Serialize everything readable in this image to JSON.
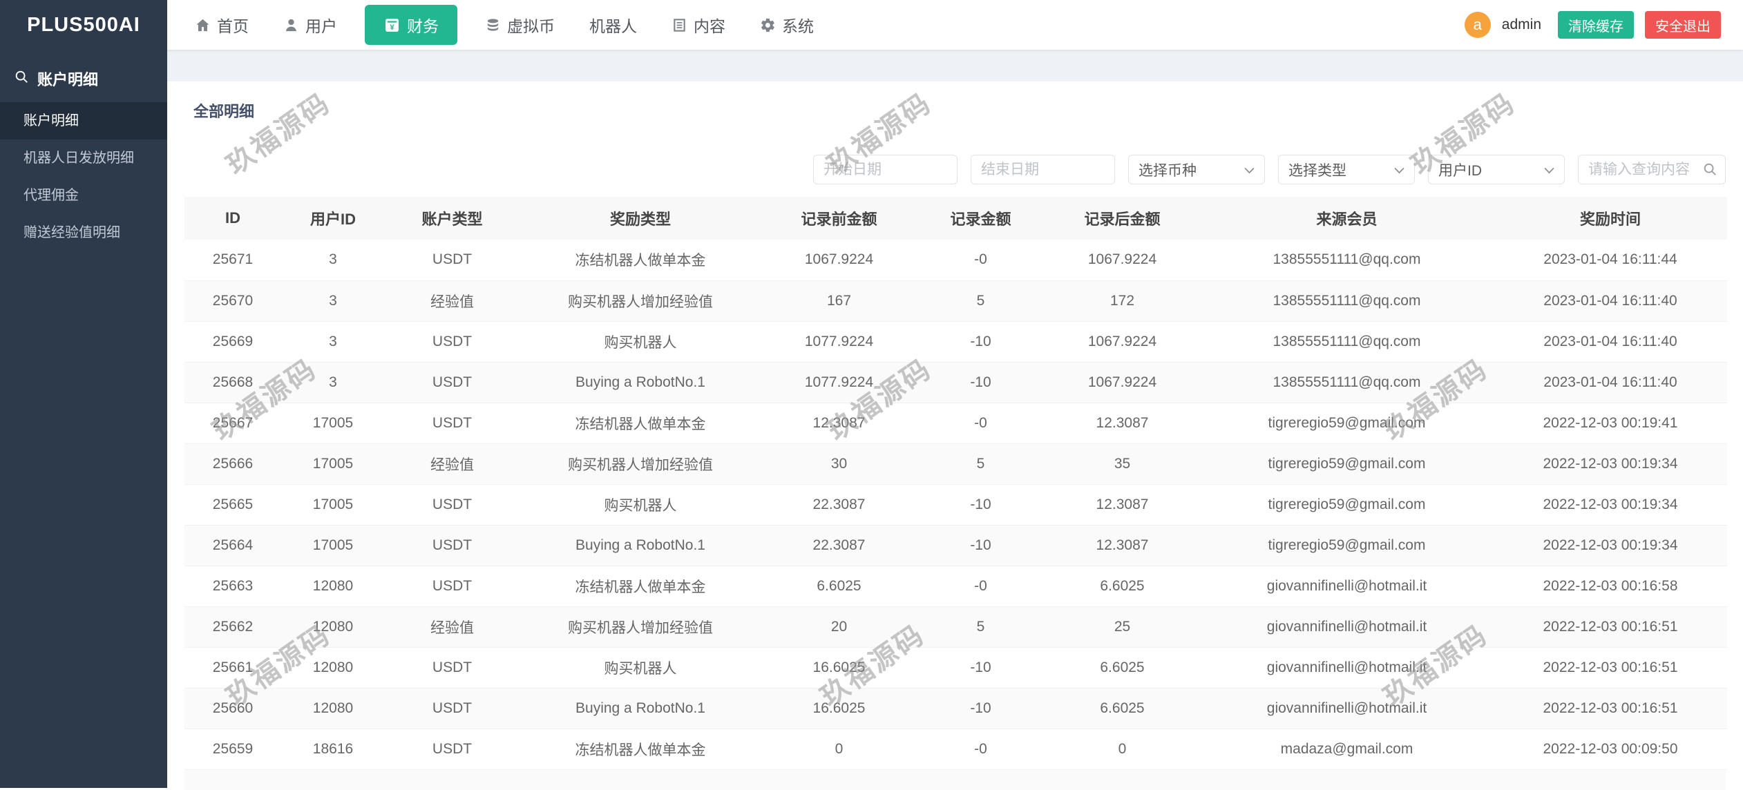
{
  "app": {
    "logo": "PLUS500AI"
  },
  "topnav": {
    "items": [
      {
        "id": "home",
        "label": "首页",
        "icon": "home-icon",
        "active": false
      },
      {
        "id": "users",
        "label": "用户",
        "icon": "user-icon",
        "active": false
      },
      {
        "id": "finance",
        "label": "财务",
        "icon": "finance-icon",
        "active": true
      },
      {
        "id": "crypto",
        "label": "虚拟币",
        "icon": "coins-icon",
        "active": false
      },
      {
        "id": "robots",
        "label": "机器人",
        "icon": null,
        "active": false
      },
      {
        "id": "content",
        "label": "内容",
        "icon": "doc-icon",
        "active": false
      },
      {
        "id": "system",
        "label": "系统",
        "icon": "gear-icon",
        "active": false
      }
    ]
  },
  "user": {
    "avatar_letter": "a",
    "name": "admin"
  },
  "header_actions": {
    "clear_cache": "清除缓存",
    "logout": "安全退出"
  },
  "sidebar": {
    "section_title": "账户明细",
    "section_icon": "search-icon",
    "items": [
      {
        "label": "账户明细",
        "active": true
      },
      {
        "label": "机器人日发放明细",
        "active": false
      },
      {
        "label": "代理佣金",
        "active": false
      },
      {
        "label": "赠送经验值明细",
        "active": false
      }
    ]
  },
  "main": {
    "title": "全部明细"
  },
  "filters": {
    "start_date_placeholder": "开始日期",
    "end_date_placeholder": "结束日期",
    "currency_select_value": "选择币种",
    "type_select_value": "选择类型",
    "field_select_value": "用户ID",
    "search_placeholder": "请输入查询内容"
  },
  "table": {
    "columns": [
      "ID",
      "用户ID",
      "账户类型",
      "奖励类型",
      "记录前金额",
      "记录金额",
      "记录后金额",
      "来源会员",
      "奖励时间"
    ],
    "rows": [
      [
        "25671",
        "3",
        "USDT",
        "冻结机器人做单本金",
        "1067.9224",
        "-0",
        "1067.9224",
        "13855551111@qq.com",
        "2023-01-04 16:11:44"
      ],
      [
        "25670",
        "3",
        "经验值",
        "购买机器人增加经验值",
        "167",
        "5",
        "172",
        "13855551111@qq.com",
        "2023-01-04 16:11:40"
      ],
      [
        "25669",
        "3",
        "USDT",
        "购买机器人",
        "1077.9224",
        "-10",
        "1067.9224",
        "13855551111@qq.com",
        "2023-01-04 16:11:40"
      ],
      [
        "25668",
        "3",
        "USDT",
        "Buying a RobotNo.1",
        "1077.9224",
        "-10",
        "1067.9224",
        "13855551111@qq.com",
        "2023-01-04 16:11:40"
      ],
      [
        "25667",
        "17005",
        "USDT",
        "冻结机器人做单本金",
        "12.3087",
        "-0",
        "12.3087",
        "tigreregio59@gmail.com",
        "2022-12-03 00:19:41"
      ],
      [
        "25666",
        "17005",
        "经验值",
        "购买机器人增加经验值",
        "30",
        "5",
        "35",
        "tigreregio59@gmail.com",
        "2022-12-03 00:19:34"
      ],
      [
        "25665",
        "17005",
        "USDT",
        "购买机器人",
        "22.3087",
        "-10",
        "12.3087",
        "tigreregio59@gmail.com",
        "2022-12-03 00:19:34"
      ],
      [
        "25664",
        "17005",
        "USDT",
        "Buying a RobotNo.1",
        "22.3087",
        "-10",
        "12.3087",
        "tigreregio59@gmail.com",
        "2022-12-03 00:19:34"
      ],
      [
        "25663",
        "12080",
        "USDT",
        "冻结机器人做单本金",
        "6.6025",
        "-0",
        "6.6025",
        "giovannifinelli@hotmail.it",
        "2022-12-03 00:16:58"
      ],
      [
        "25662",
        "12080",
        "经验值",
        "购买机器人增加经验值",
        "20",
        "5",
        "25",
        "giovannifinelli@hotmail.it",
        "2022-12-03 00:16:51"
      ],
      [
        "25661",
        "12080",
        "USDT",
        "购买机器人",
        "16.6025",
        "-10",
        "6.6025",
        "giovannifinelli@hotmail.it",
        "2022-12-03 00:16:51"
      ],
      [
        "25660",
        "12080",
        "USDT",
        "Buying a RobotNo.1",
        "16.6025",
        "-10",
        "6.6025",
        "giovannifinelli@hotmail.it",
        "2022-12-03 00:16:51"
      ],
      [
        "25659",
        "18616",
        "USDT",
        "冻结机器人做单本金",
        "0",
        "-0",
        "0",
        "madaza@gmail.com",
        "2022-12-03 00:09:50"
      ]
    ]
  },
  "watermark": {
    "text": "玖福源码"
  },
  "colors": {
    "accent": "#23b791",
    "danger": "#f15553",
    "avatar": "#f6a23d",
    "sidebar": "#2d3a4b"
  }
}
